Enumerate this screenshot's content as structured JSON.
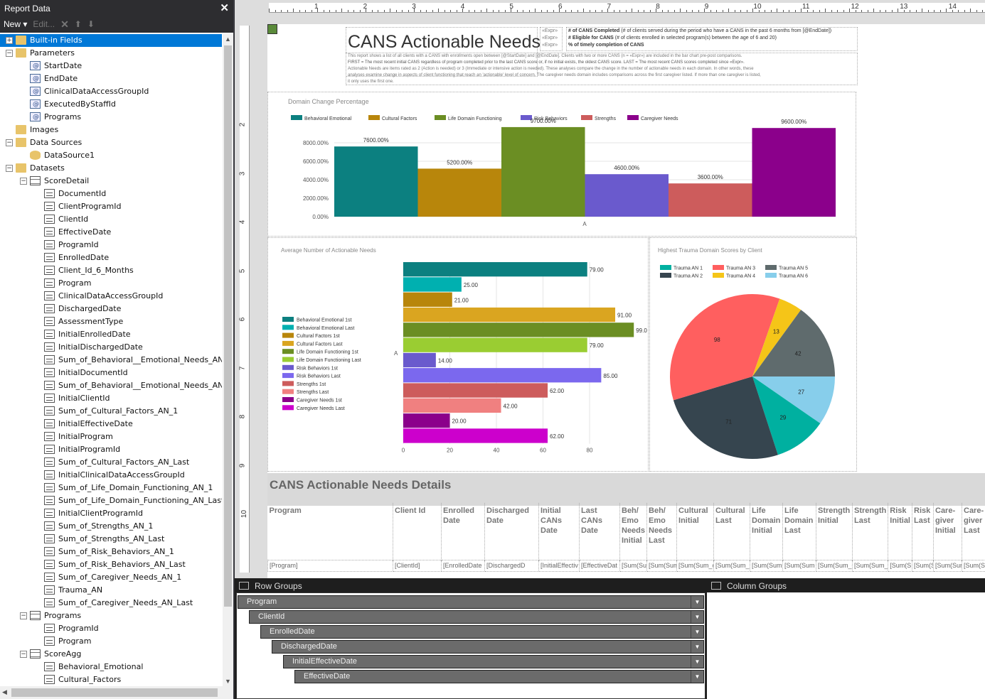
{
  "left_panel": {
    "title": "Report Data",
    "toolbar": {
      "new": "New",
      "edit": "Edit..."
    },
    "tree": [
      {
        "label": "Built-in Fields",
        "type": "folder",
        "level": 0,
        "toggle": "+",
        "selected": true
      },
      {
        "label": "Parameters",
        "type": "folder",
        "level": 0,
        "toggle": "−"
      },
      {
        "label": "StartDate",
        "type": "param",
        "level": 1
      },
      {
        "label": "EndDate",
        "type": "param",
        "level": 1
      },
      {
        "label": "ClinicalDataAccessGroupId",
        "type": "param",
        "level": 1
      },
      {
        "label": "ExecutedByStaffId",
        "type": "param",
        "level": 1
      },
      {
        "label": "Programs",
        "type": "param",
        "level": 1
      },
      {
        "label": "Images",
        "type": "folder",
        "level": 0
      },
      {
        "label": "Data Sources",
        "type": "folder",
        "level": 0,
        "toggle": "−"
      },
      {
        "label": "DataSource1",
        "type": "dsrc",
        "level": 1
      },
      {
        "label": "Datasets",
        "type": "folder",
        "level": 0,
        "toggle": "−"
      },
      {
        "label": "ScoreDetail",
        "type": "dset",
        "level": 1,
        "toggle": "−"
      },
      {
        "label": "DocumentId",
        "type": "field",
        "level": 2
      },
      {
        "label": "ClientProgramId",
        "type": "field",
        "level": 2
      },
      {
        "label": "ClientId",
        "type": "field",
        "level": 2
      },
      {
        "label": "EffectiveDate",
        "type": "field",
        "level": 2
      },
      {
        "label": "ProgramId",
        "type": "field",
        "level": 2
      },
      {
        "label": "EnrolledDate",
        "type": "field",
        "level": 2
      },
      {
        "label": "Client_Id_6_Months",
        "type": "field",
        "level": 2
      },
      {
        "label": "Program",
        "type": "field",
        "level": 2
      },
      {
        "label": "ClinicalDataAccessGroupId",
        "type": "field",
        "level": 2
      },
      {
        "label": "DischargedDate",
        "type": "field",
        "level": 2
      },
      {
        "label": "AssessmentType",
        "type": "field",
        "level": 2
      },
      {
        "label": "InitialEnrolledDate",
        "type": "field",
        "level": 2
      },
      {
        "label": "InitialDischargedDate",
        "type": "field",
        "level": 2
      },
      {
        "label": "Sum_of_Behavioral__Emotional_Needs_AN_1",
        "type": "field",
        "level": 2
      },
      {
        "label": "InitialDocumentId",
        "type": "field",
        "level": 2
      },
      {
        "label": "Sum_of_Behavioral__Emotional_Needs_AN_La",
        "type": "field",
        "level": 2
      },
      {
        "label": "InitialClientId",
        "type": "field",
        "level": 2
      },
      {
        "label": "Sum_of_Cultural_Factors_AN_1",
        "type": "field",
        "level": 2
      },
      {
        "label": "InitialEffectiveDate",
        "type": "field",
        "level": 2
      },
      {
        "label": "InitialProgram",
        "type": "field",
        "level": 2
      },
      {
        "label": "InitialProgramId",
        "type": "field",
        "level": 2
      },
      {
        "label": "Sum_of_Cultural_Factors_AN_Last",
        "type": "field",
        "level": 2
      },
      {
        "label": "InitialClinicalDataAccessGroupId",
        "type": "field",
        "level": 2
      },
      {
        "label": "Sum_of_Life_Domain_Functioning_AN_1",
        "type": "field",
        "level": 2
      },
      {
        "label": "Sum_of_Life_Domain_Functioning_AN_Last",
        "type": "field",
        "level": 2
      },
      {
        "label": "InitialClientProgramId",
        "type": "field",
        "level": 2
      },
      {
        "label": "Sum_of_Strengths_AN_1",
        "type": "field",
        "level": 2
      },
      {
        "label": "Sum_of_Strengths_AN_Last",
        "type": "field",
        "level": 2
      },
      {
        "label": "Sum_of_Risk_Behaviors_AN_1",
        "type": "field",
        "level": 2
      },
      {
        "label": "Sum_of_Risk_Behaviors_AN_Last",
        "type": "field",
        "level": 2
      },
      {
        "label": "Sum_of_Caregiver_Needs_AN_1",
        "type": "field",
        "level": 2
      },
      {
        "label": "Trauma_AN",
        "type": "field",
        "level": 2
      },
      {
        "label": "Sum_of_Caregiver_Needs_AN_Last",
        "type": "field",
        "level": 2
      },
      {
        "label": "Programs",
        "type": "dset",
        "level": 1,
        "toggle": "−"
      },
      {
        "label": "ProgramId",
        "type": "field",
        "level": 2
      },
      {
        "label": "Program",
        "type": "field",
        "level": 2
      },
      {
        "label": "ScoreAgg",
        "type": "dset",
        "level": 1,
        "toggle": "−"
      },
      {
        "label": "Behavioral_Emotional",
        "type": "field",
        "level": 2
      },
      {
        "label": "Cultural_Factors",
        "type": "field",
        "level": 2
      }
    ]
  },
  "ruler": {
    "h": [
      "1",
      "2",
      "3",
      "4",
      "5",
      "6",
      "7",
      "8",
      "9",
      "10",
      "11",
      "12",
      "13",
      "14"
    ],
    "v": [
      "2",
      "3",
      "4",
      "5",
      "6",
      "7",
      "8",
      "9",
      "10"
    ]
  },
  "report": {
    "title": "CANS Actionable Needs",
    "exprs": [
      "«Expr»",
      "«Expr»",
      "«Expr»"
    ],
    "stats": [
      {
        "b": "# of CANS Completed",
        "t": "(# of clients served during the period who have a CANS in the past 6 months from [@EndDate])"
      },
      {
        "b": "# Eligible for CANS",
        "t": "(# of clients enrolled in selected program(s) between the age of 6 and 20)"
      },
      {
        "b": "% of timely completion of CANS",
        "t": ""
      }
    ],
    "desc": [
      "This report shows a list of all clients with a CANS with enrollments open between [@StartDate] and [@EndDate]. Clients with two or more CANS (n = «Expr») are included in the bar chart pre-post comparisons.",
      "FIRST = The most recent initial CANS regardless of program completed prior to the last CANS score or, if no initial exists, the oldest CANS score. LAST = The most recent CANS scores completed since «Expr».",
      "Actionable Needs are items rated as 2 (Action is needed) or 3 (Immediate or intensive action is needed). These analyses compare the change in the number of actionable needs in each domain. In other words, these",
      "analyses examine change in aspects of client functioning that reach an 'actionable' level of concern. The caregiver needs domain includes comparisons across the first caregiver listed. If more than one caregiver is listed,",
      "it only uses the first one."
    ]
  },
  "chart_data": [
    {
      "type": "bar",
      "title": "Domain Change Percentage",
      "categories": [
        "A"
      ],
      "series": [
        {
          "name": "Behavioral Emotional",
          "values": [
            7600
          ],
          "label": "7600.00%",
          "color": "#0c8080"
        },
        {
          "name": "Cultural Factors",
          "values": [
            5200
          ],
          "label": "5200.00%",
          "color": "#b8860b"
        },
        {
          "name": "Life Domain Functioning",
          "values": [
            9700
          ],
          "label": "9700.00%",
          "color": "#6b8e23"
        },
        {
          "name": "Risk Behaviors",
          "values": [
            4600
          ],
          "label": "4600.00%",
          "color": "#6a5acd"
        },
        {
          "name": "Strengths",
          "values": [
            3600
          ],
          "label": "3600.00%",
          "color": "#cd5c5c"
        },
        {
          "name": "Caregiver Needs",
          "values": [
            9600
          ],
          "label": "9600.00%",
          "color": "#8b008b"
        }
      ],
      "yticks": [
        "0.00%",
        "2000.00%",
        "4000.00%",
        "6000.00%",
        "8000.00%"
      ],
      "ylim": [
        0,
        10000
      ],
      "legend": "top"
    },
    {
      "type": "bar",
      "orientation": "horizontal",
      "title": "Average Number of Actionable Needs",
      "categories": [
        "A"
      ],
      "series": [
        {
          "name": "Behavioral Emotional 1st",
          "values": [
            79
          ],
          "label": "79.00",
          "color": "#0c8080"
        },
        {
          "name": "Behavioral Emotional Last",
          "values": [
            25
          ],
          "label": "25.00",
          "color": "#00b0b0"
        },
        {
          "name": "Cultural Factors 1st",
          "values": [
            21
          ],
          "label": "21.00",
          "color": "#b8860b"
        },
        {
          "name": "Cultural Factors Last",
          "values": [
            91
          ],
          "label": "91.00",
          "color": "#daa520"
        },
        {
          "name": "Life Domain Functioning 1st",
          "values": [
            99
          ],
          "label": "99.0",
          "color": "#6b8e23"
        },
        {
          "name": "Life Domain Functioning Last",
          "values": [
            79
          ],
          "label": "79.00",
          "color": "#9acd32"
        },
        {
          "name": "Risk Behaviors 1st",
          "values": [
            14
          ],
          "label": "14.00",
          "color": "#6a5acd"
        },
        {
          "name": "Risk Behaviors Last",
          "values": [
            85
          ],
          "label": "85.00",
          "color": "#7b68ee"
        },
        {
          "name": "Strengths 1st",
          "values": [
            62
          ],
          "label": "62.00",
          "color": "#cd5c5c"
        },
        {
          "name": "Strengths Last",
          "values": [
            42
          ],
          "label": "42.00",
          "color": "#f08080"
        },
        {
          "name": "Caregiver Needs 1st",
          "values": [
            20
          ],
          "label": "20.00",
          "color": "#8b008b"
        },
        {
          "name": "Caregiver Needs Last",
          "values": [
            62
          ],
          "label": "62.00",
          "color": "#cc00cc"
        }
      ],
      "xticks": [
        "0",
        "20",
        "40",
        "60",
        "80"
      ],
      "xlim": [
        0,
        80
      ],
      "legend": "left"
    },
    {
      "type": "pie",
      "title": "Highest Trauma Domain Scores by Client",
      "slices": [
        {
          "name": "Trauma AN 6",
          "value": 27,
          "color": "#87ceeb"
        },
        {
          "name": "Trauma AN 1",
          "value": 29,
          "color": "#00b0a0"
        },
        {
          "name": "Trauma AN 2",
          "value": 71,
          "color": "#36454f"
        },
        {
          "name": "Trauma AN 3",
          "value": 98,
          "color": "#ff5f5f"
        },
        {
          "name": "Trauma AN 4",
          "value": 13,
          "color": "#f5c518"
        },
        {
          "name": "Trauma AN 5",
          "value": 42,
          "color": "#5f6b6d"
        }
      ],
      "legend_order": [
        "Trauma AN 1",
        "Trauma AN 2",
        "Trauma AN 3",
        "Trauma AN 4",
        "Trauma AN 5",
        "Trauma AN 6"
      ],
      "legend": "top-left"
    }
  ],
  "details": {
    "title": "CANS Actionable Needs Details",
    "headers": [
      "Program",
      "Client Id",
      "Enrolled\nDate",
      "Discharged\nDate",
      "Initial\nCANs Date",
      "Last CANs\nDate",
      "Beh/\nEmo\nNeeds\nInitial",
      "Beh/\nEmo\nNeeds\nLast",
      "Cultural\nInitial",
      "Cultural\nLast",
      "Life\nDomain\nInitial",
      "Life\nDomain\nLast",
      "Strength\nInitial",
      "Strength\nLast",
      "Risk\nInitial",
      "Risk\nLast",
      "Care-\ngiver\nInitial",
      "Care-\ngiver\nLast"
    ],
    "cells": [
      "[Program]",
      "[ClientId]",
      "[EnrolledDate",
      "[DischargedD",
      "[InitialEffectiv",
      "[EffectiveDat",
      "[Sum(Sum",
      "[Sum(Sum",
      "[Sum(Sum_c",
      "[Sum(Sum_",
      "[Sum(Sum",
      "[Sum(Sum",
      "[Sum(Sum_o",
      "[Sum(Sum_o",
      "[Sum(S",
      "[Sum(S",
      "[Sum(Sur",
      "[Sum(Sur"
    ]
  },
  "groups": {
    "row_title": "Row Groups",
    "col_title": "Column Groups",
    "rows": [
      "Program",
      "ClientId",
      "EnrolledDate",
      "DischargedDate",
      "InitialEffectiveDate",
      "EffectiveDate"
    ]
  }
}
